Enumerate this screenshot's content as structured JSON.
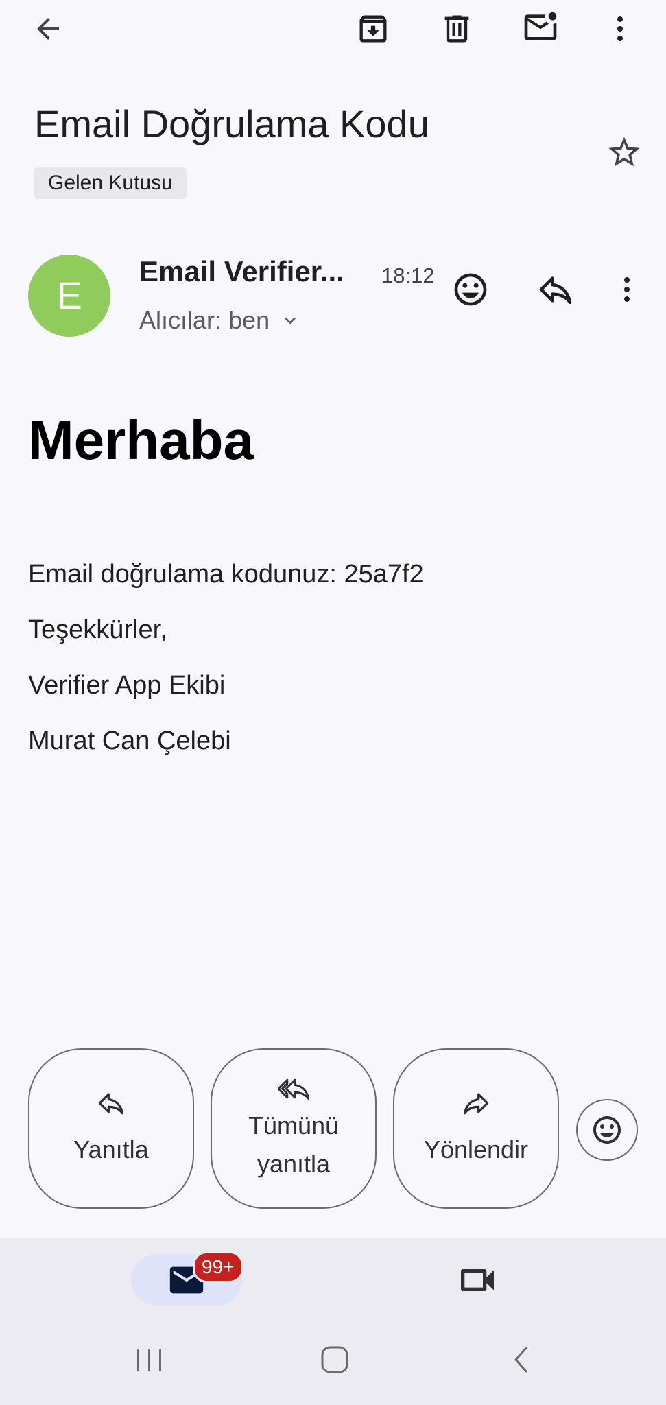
{
  "email": {
    "subject": "Email Doğrulama Kodu",
    "label": "Gelen Kutusu",
    "sender_initial": "E",
    "sender_name": "Email Verifier...",
    "time": "18:12",
    "recipients": "Alıcılar: ben"
  },
  "body": {
    "greeting": "Merhaba",
    "lines": [
      "Email doğrulama kodunuz: 25a7f2",
      "Teşekkürler,",
      "Verifier App Ekibi",
      "Murat Can Çelebi"
    ]
  },
  "actions": {
    "reply": "Yanıtla",
    "reply_all_line1": "Tümünü",
    "reply_all_line2": "yanıtla",
    "forward": "Yönlendir"
  },
  "bottom_nav": {
    "mail_badge": "99+"
  },
  "colors": {
    "avatar": "#8fcc5b",
    "badge": "#c5221f",
    "background": "#f8f7fc"
  }
}
